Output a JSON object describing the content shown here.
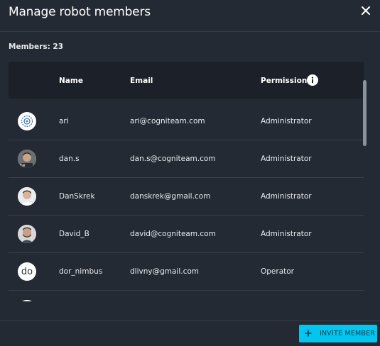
{
  "dialog": {
    "title": "Manage robot members",
    "members_count": "Members: 23"
  },
  "table": {
    "headers": {
      "name": "Name",
      "email": "Email",
      "permission": "Permission"
    },
    "rows": [
      {
        "name": "ari",
        "email": "ari@cogniteam.com",
        "permission": "Administrator",
        "avatar": "robot-logo-icon"
      },
      {
        "name": "dan.s",
        "email": "dan.s@cogniteam.com",
        "permission": "Administrator",
        "avatar": "user-photo"
      },
      {
        "name": "DanSkrek",
        "email": "danskrek@gmail.com",
        "permission": "Administrator",
        "avatar": "user-photo"
      },
      {
        "name": "David_B",
        "email": "david@cogniteam.com",
        "permission": "Administrator",
        "avatar": "user-photo"
      },
      {
        "name": "dor_nimbus",
        "email": "dlivny@gmail.com",
        "permission": "Operator",
        "avatar": "initials",
        "initials": "do"
      },
      {
        "name": "",
        "email": "",
        "permission": "",
        "avatar": "initials",
        "initials": ""
      }
    ]
  },
  "footer": {
    "invite_label": "INVITE MEMBER"
  },
  "icons": {
    "close": "close-icon",
    "info": "info-icon",
    "add": "plus-icon"
  },
  "colors": {
    "background": "#242a33",
    "header_bg": "#1c2129",
    "accent": "#00c6f0",
    "divider": "#39404b"
  }
}
